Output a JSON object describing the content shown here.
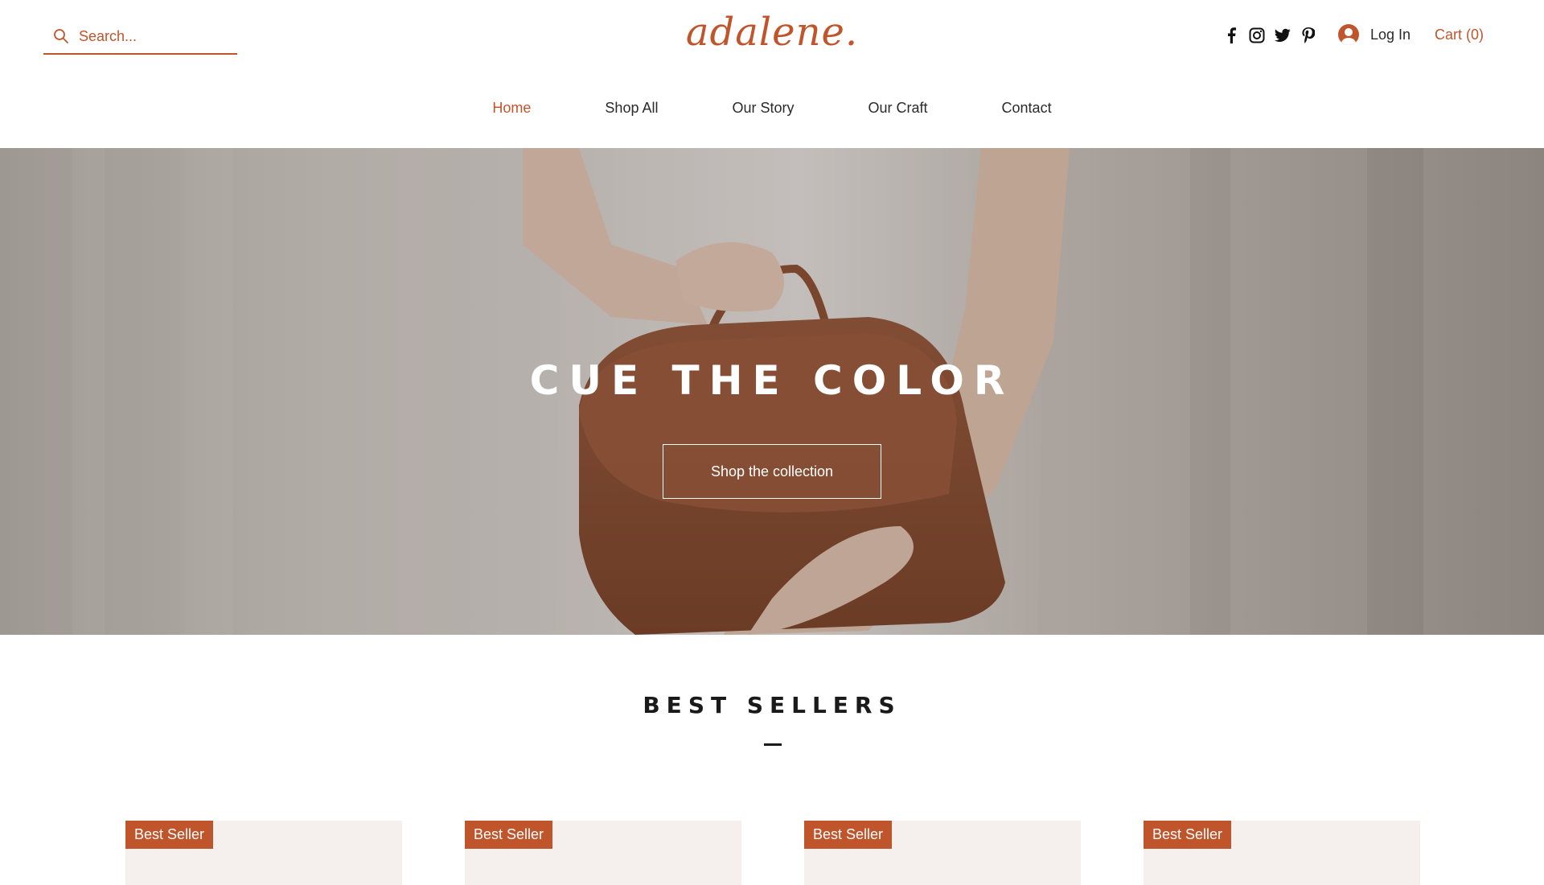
{
  "search": {
    "placeholder": "Search..."
  },
  "brand": {
    "logo": "adalene."
  },
  "social": {
    "icons": [
      "facebook-icon",
      "instagram-icon",
      "twitter-icon",
      "pinterest-icon"
    ]
  },
  "account": {
    "login_label": "Log In"
  },
  "cart": {
    "label": "Cart",
    "count": "0"
  },
  "nav": {
    "items": [
      {
        "label": "Home",
        "active": true
      },
      {
        "label": "Shop All"
      },
      {
        "label": "Our Story"
      },
      {
        "label": "Our Craft"
      },
      {
        "label": "Contact"
      }
    ]
  },
  "hero": {
    "title": "CUE THE COLOR",
    "button_label": "Shop the collection"
  },
  "best_sellers": {
    "title": "BEST SELLERS",
    "products": [
      {
        "badge": "Best Seller"
      },
      {
        "badge": "Best Seller"
      },
      {
        "badge": "Best Seller"
      },
      {
        "badge": "Best Seller"
      }
    ]
  },
  "colors": {
    "accent": "#c0552c",
    "text": "#1a1a1a",
    "card_bg": "#f5f0ee"
  }
}
